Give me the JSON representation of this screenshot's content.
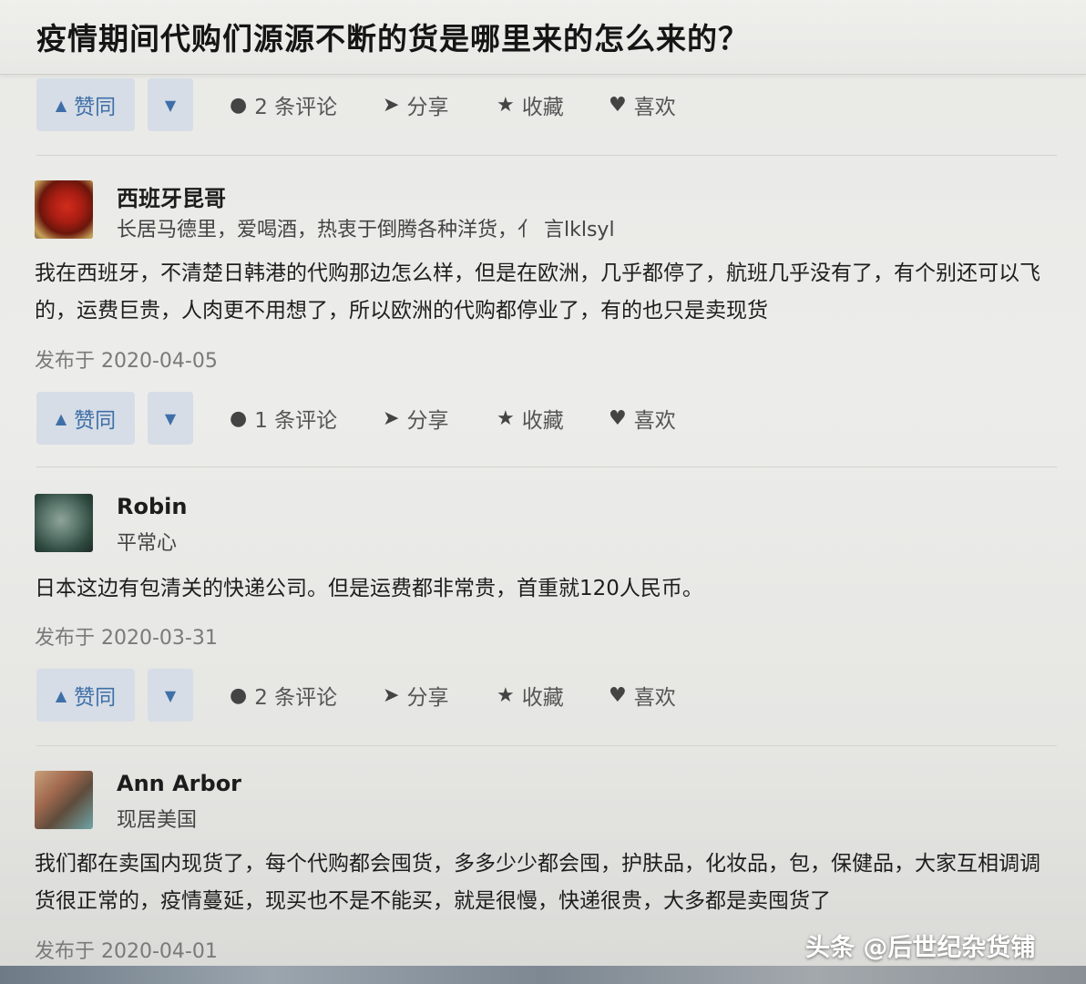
{
  "page": {
    "title": "疫情期间代购们源源不断的货是哪里来的怎么来的？"
  },
  "actions": [
    {
      "vote_up": "赞同",
      "comments": "2 条评论",
      "share": "分享",
      "collect": "收藏",
      "like": "喜欢"
    },
    {
      "vote_up": "赞同",
      "comments": "1 条评论",
      "share": "分享",
      "collect": "收藏",
      "like": "喜欢"
    },
    {
      "vote_up": "赞同",
      "comments": "2 条评论",
      "share": "分享",
      "collect": "收藏",
      "like": "喜欢"
    }
  ],
  "answers": [
    {
      "author": "西班牙昆哥",
      "bio": "长居马德里，爱喝酒，热衷于倒腾各种洋货，亻 言lklsyl",
      "body": "我在西班牙，不清楚日韩港的代购那边怎么样，但是在欧洲，几乎都停了，航班几乎没有了，有个别还可以飞的，运费巨贵，人肉更不用想了，所以欧洲的代购都停业了，有的也只是卖现货",
      "date": "发布于 2020-04-05"
    },
    {
      "author": "Robin",
      "bio": "平常心",
      "body": "日本这边有包清关的快递公司。但是运费都非常贵，首重就120人民币。",
      "date": "发布于 2020-03-31"
    },
    {
      "author": "Ann Arbor",
      "bio": "现居美国",
      "body": "我们都在卖国内现货了，每个代购都会囤货，多多少少都会囤，护肤品，化妆品，包，保健品，大家互相调调货很正常的，疫情蔓延，现买也不是不能买，就是很慢，快递很贵，大多都是卖囤货了",
      "date": "发布于 2020-04-01"
    }
  ],
  "watermark": "头条 @后世纪杂货铺"
}
